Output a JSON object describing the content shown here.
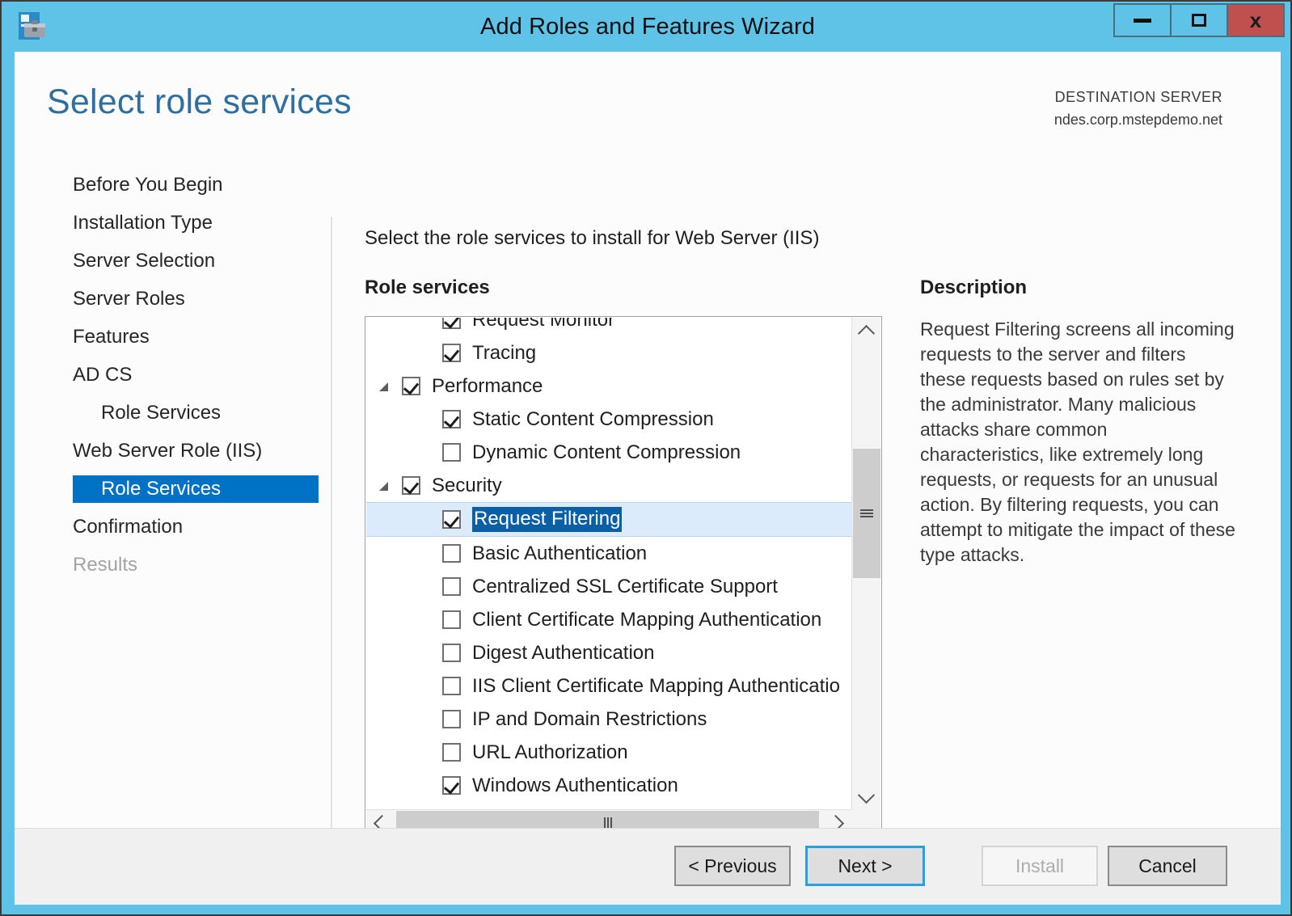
{
  "window": {
    "title": "Add Roles and Features Wizard",
    "icon": "wizard-roles-icon",
    "minimize_label": "",
    "maximize_label": "",
    "close_label": "x",
    "titlebar_color": "#5FC3E8",
    "close_color": "#c0504d"
  },
  "page": {
    "title": "Select role services",
    "accent_color": "#2E6FA0"
  },
  "destination": {
    "label": "DESTINATION SERVER",
    "value": "ndes.corp.mstepdemo.net"
  },
  "sidebar": {
    "selected_color": "#0072C6",
    "items": [
      {
        "label": "Before You Begin",
        "level": 0,
        "state": "normal"
      },
      {
        "label": "Installation Type",
        "level": 0,
        "state": "normal"
      },
      {
        "label": "Server Selection",
        "level": 0,
        "state": "normal"
      },
      {
        "label": "Server Roles",
        "level": 0,
        "state": "normal"
      },
      {
        "label": "Features",
        "level": 0,
        "state": "normal"
      },
      {
        "label": "AD CS",
        "level": 0,
        "state": "normal"
      },
      {
        "label": "Role Services",
        "level": 1,
        "state": "normal"
      },
      {
        "label": "Web Server Role (IIS)",
        "level": 0,
        "state": "normal"
      },
      {
        "label": "Role Services",
        "level": 1,
        "state": "selected"
      },
      {
        "label": "Confirmation",
        "level": 0,
        "state": "normal"
      },
      {
        "label": "Results",
        "level": 0,
        "state": "disabled"
      }
    ]
  },
  "main": {
    "intro": "Select the role services to install for Web Server (IIS)",
    "role_services_label": "Role services",
    "description_label": "Description",
    "description_text": "Request Filtering screens all incoming requests to the server and filters these requests based on rules set by the administrator. Many malicious attacks share common characteristics, like extremely long requests, or requests for an unusual action. By filtering requests, you can attempt to mitigate the impact of these type attacks.",
    "highlight_row_bg": "#DCEBFB",
    "highlight_text_bg": "#0B5FA5"
  },
  "tree": {
    "rows": [
      {
        "label": "Request Monitor",
        "level": 2,
        "checked": true,
        "expander": "none",
        "selected": false
      },
      {
        "label": "Tracing",
        "level": 2,
        "checked": true,
        "expander": "none",
        "selected": false
      },
      {
        "label": "Performance",
        "level": 1,
        "checked": true,
        "expander": "expanded",
        "selected": false
      },
      {
        "label": "Static Content Compression",
        "level": 2,
        "checked": true,
        "expander": "none",
        "selected": false
      },
      {
        "label": "Dynamic Content Compression",
        "level": 2,
        "checked": false,
        "expander": "none",
        "selected": false
      },
      {
        "label": "Security",
        "level": 1,
        "checked": true,
        "expander": "expanded",
        "selected": false
      },
      {
        "label": "Request Filtering",
        "level": 2,
        "checked": true,
        "expander": "none",
        "selected": true
      },
      {
        "label": "Basic Authentication",
        "level": 2,
        "checked": false,
        "expander": "none",
        "selected": false
      },
      {
        "label": "Centralized SSL Certificate Support",
        "level": 2,
        "checked": false,
        "expander": "none",
        "selected": false
      },
      {
        "label": "Client Certificate Mapping Authentication",
        "level": 2,
        "checked": false,
        "expander": "none",
        "selected": false
      },
      {
        "label": "Digest Authentication",
        "level": 2,
        "checked": false,
        "expander": "none",
        "selected": false
      },
      {
        "label": "IIS Client Certificate Mapping Authenticatio",
        "level": 2,
        "checked": false,
        "expander": "none",
        "selected": false
      },
      {
        "label": "IP and Domain Restrictions",
        "level": 2,
        "checked": false,
        "expander": "none",
        "selected": false
      },
      {
        "label": "URL Authorization",
        "level": 2,
        "checked": false,
        "expander": "none",
        "selected": false
      },
      {
        "label": "Windows Authentication",
        "level": 2,
        "checked": true,
        "expander": "none",
        "selected": false
      }
    ]
  },
  "scrollbars": {
    "vertical": {
      "up_icon": "chevron-up-icon",
      "down_icon": "chevron-down-icon",
      "thumb_grip": "grip-icon"
    },
    "horizontal": {
      "left_icon": "chevron-left-icon",
      "right_icon": "chevron-right-icon",
      "thumb_grip": "grip-icon"
    }
  },
  "footer": {
    "previous_label": "< Previous",
    "next_label": "Next >",
    "install_label": "Install",
    "cancel_label": "Cancel"
  }
}
